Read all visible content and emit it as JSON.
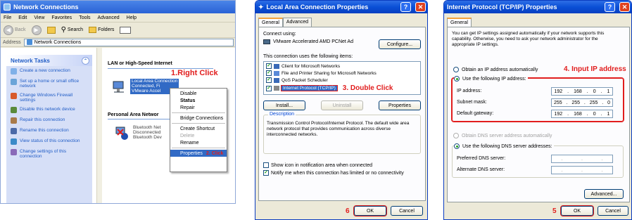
{
  "win1": {
    "title": "Network Connections",
    "menu": [
      "File",
      "Edit",
      "View",
      "Favorites",
      "Tools",
      "Advanced",
      "Help"
    ],
    "toolbar": {
      "back": "Back",
      "search": "Search",
      "folders": "Folders"
    },
    "address_label": "Address",
    "address_value": "Network Connections",
    "tasks_title": "Network Tasks",
    "tasks": [
      "Create a new connection",
      "Set up a home or small office network",
      "Change Windows Firewall settings",
      "Disable this network device",
      "Repair this connection",
      "Rename this connection",
      "View status of this connection",
      "Change settings of this connection"
    ],
    "section_lan": "LAN or High-Speed Internet",
    "section_pan": "Personal Area Networ",
    "lan_conn": [
      "Local Area Connection",
      "Connected, Fi",
      "VMware Accel"
    ],
    "bt_conn": [
      "Bluetooth Net",
      "Disconnected",
      "Bluetooth Dev"
    ],
    "context_menu": [
      "Disable",
      "Status",
      "Repair",
      "Bridge Connections",
      "Create Shortcut",
      "Delete",
      "Rename",
      "Properties"
    ],
    "annot_right_click": "1.Right Click",
    "annot_click": "2. Click"
  },
  "win2": {
    "title": "Local Area Connection Properties",
    "tabs": [
      "General",
      "Advanced"
    ],
    "connect_using_label": "Connect using:",
    "adapter": "VMware Accelerated AMD PCNet Ad",
    "configure_btn": "Configure...",
    "items_label": "This connection uses the following items:",
    "items": [
      "Client for Microsoft Networks",
      "File and Printer Sharing for Microsoft Networks",
      "QoS Packet Scheduler",
      "Internet Protocol (TCP/IP)"
    ],
    "annot_double_click": "3. Double Click",
    "install_btn": "Install...",
    "uninstall_btn": "Uninstall",
    "properties_btn": "Properties",
    "description_label": "Description",
    "description_text": "Transmission Control Protocol/Internet Protocol. The default wide area network protocol that provides communication across diverse interconnected networks.",
    "show_icon": "Show icon in notification area when connected",
    "notify": "Notify me when this connection has limited or no connectivity",
    "step_num": "6",
    "ok_btn": "OK",
    "cancel_btn": "Cancel"
  },
  "win3": {
    "title": "Internet Protocol (TCP/IP) Properties",
    "tab": "General",
    "intro": "You can get IP settings assigned automatically if your network supports this capability. Otherwise, you need to ask your network administrator for the appropriate IP settings.",
    "obtain_auto": "Obtain an IP address automatically",
    "use_following": "Use the following IP address:",
    "annot_input": "4. Input IP address",
    "ip_label": "IP address:",
    "ip_value": [
      "192",
      "168",
      "0",
      "1"
    ],
    "mask_label": "Subnet mask:",
    "mask_value": [
      "255",
      "255",
      "255",
      "0"
    ],
    "gw_label": "Default gateway:",
    "gw_value": [
      "192",
      "168",
      "0",
      "1"
    ],
    "dns_auto": "Obtain DNS server address automatically",
    "dns_use": "Use the following DNS server addresses:",
    "pref_dns": "Preferred DNS server:",
    "alt_dns": "Alternate DNS server:",
    "advanced_btn": "Advanced...",
    "step_num": "5",
    "ok_btn": "OK",
    "cancel_btn": "Cancel"
  }
}
